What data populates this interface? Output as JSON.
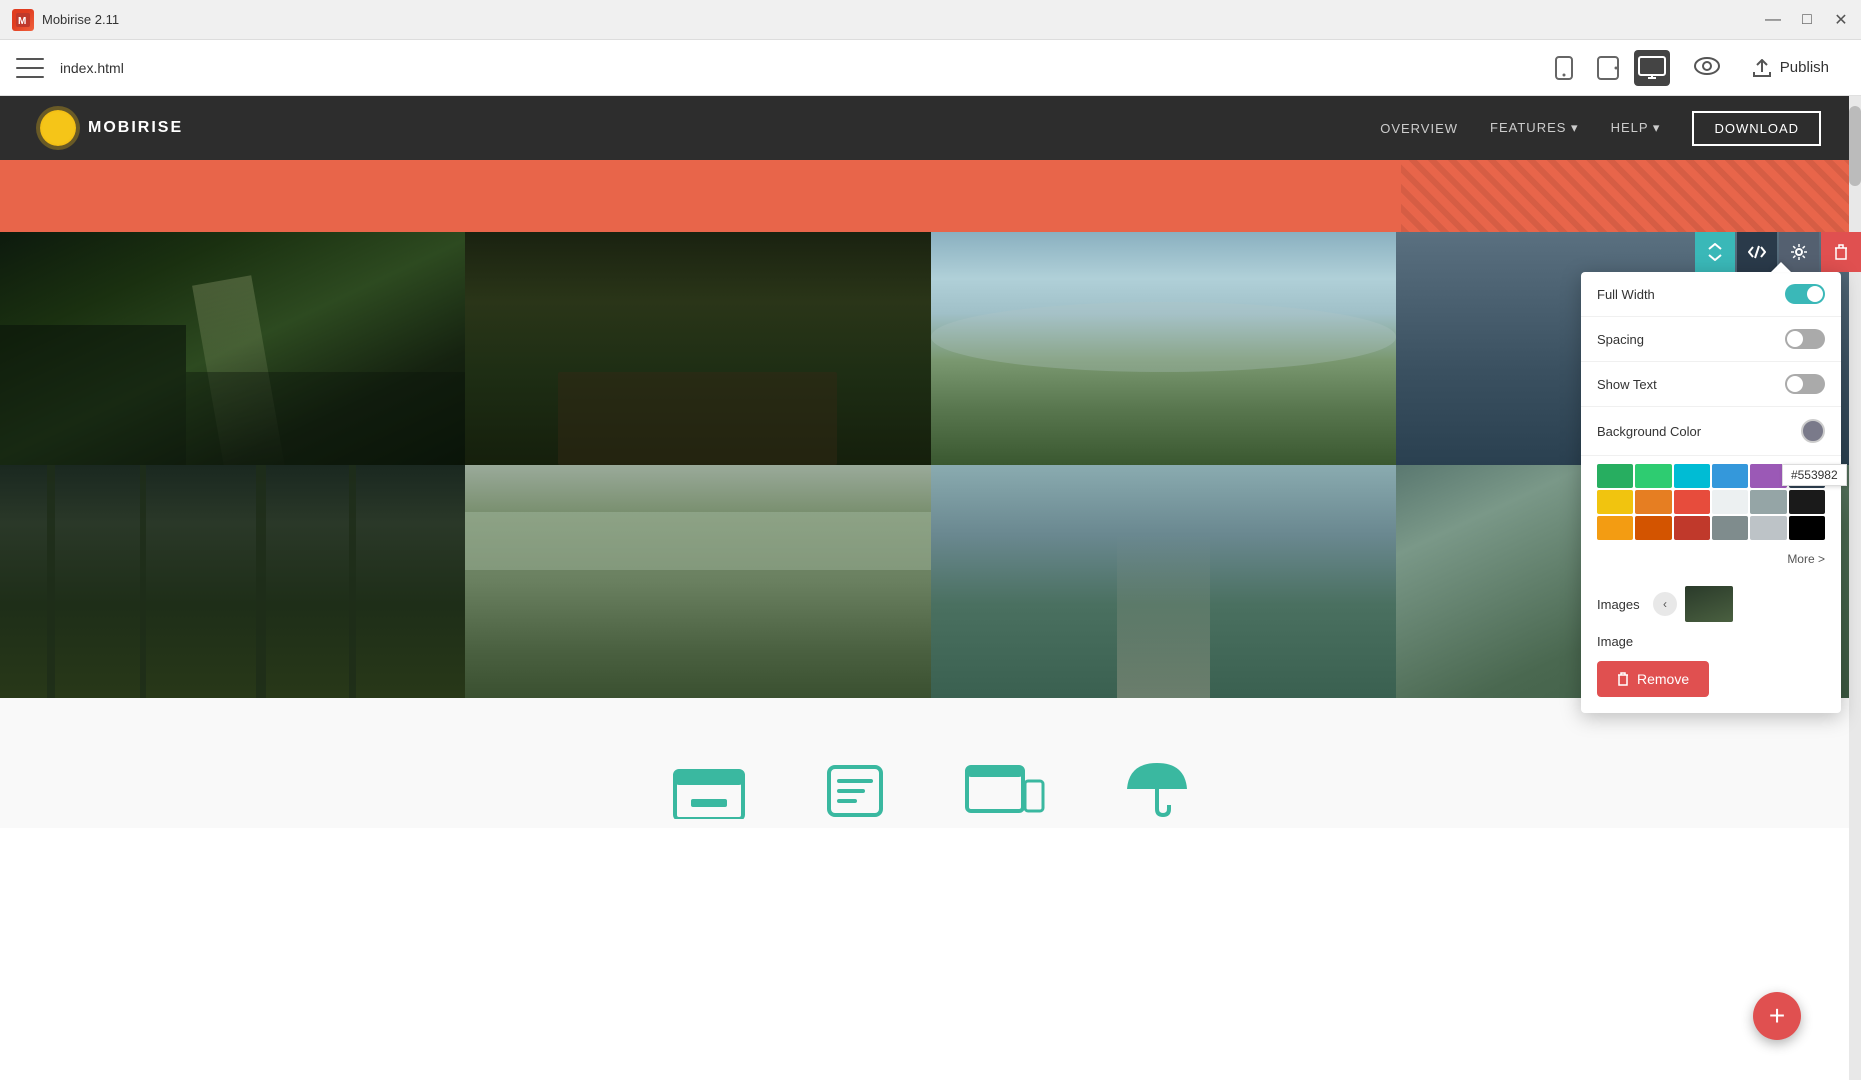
{
  "titlebar": {
    "logo_text": "M:",
    "title": "Mobirise 2.11",
    "minimize": "—",
    "maximize": "□",
    "close": "✕"
  },
  "toolbar": {
    "menu_label": "menu",
    "filename": "index.html",
    "device_mobile_label": "mobile",
    "device_tablet_label": "tablet",
    "device_desktop_label": "desktop",
    "preview_label": "preview",
    "publish_label": "Publish"
  },
  "site_navbar": {
    "logo_text": "MOBIRISE",
    "nav_items": [
      "OVERVIEW",
      "FEATURES",
      "HELP",
      "DOWNLOAD"
    ]
  },
  "settings_panel": {
    "full_width_label": "Full Width",
    "full_width_value": "on",
    "spacing_label": "Spacing",
    "spacing_value": "off",
    "show_text_label": "Show Text",
    "show_text_value": "off",
    "background_color_label": "Background Color",
    "images_label": "Images",
    "image_label": "Image",
    "more_label": "More >",
    "remove_label": "Remove",
    "color_tooltip": "#553982",
    "colors_row1": [
      "#27ae60",
      "#2ecc71",
      "#00bcd4",
      "#3498db",
      "#9b59b6",
      "#2c3e50"
    ],
    "colors_row2": [
      "#f1c40f",
      "#e67e22",
      "#e74c3c",
      "#ecf0f1",
      "#95a5a6",
      "#1a1a1a"
    ],
    "colors_row3": [
      "#f39c12",
      "#d35400",
      "#c0392b",
      "#7f8c8d",
      "#bdc3c7",
      "#000000"
    ]
  },
  "gallery": {
    "images": [
      {
        "label": "forest-sunbeam"
      },
      {
        "label": "path-bench"
      },
      {
        "label": "mountains-fog"
      },
      {
        "label": "forest-dark"
      },
      {
        "label": "dark-forest-tall"
      },
      {
        "label": "fog-forest-path"
      },
      {
        "label": "road-mountains"
      },
      {
        "label": "light-forest"
      }
    ]
  },
  "bottom_section": {
    "icons": [
      "browser-icon",
      "app-icon",
      "responsive-icon",
      "umbrella-icon"
    ]
  },
  "fab": {
    "label": "+"
  }
}
